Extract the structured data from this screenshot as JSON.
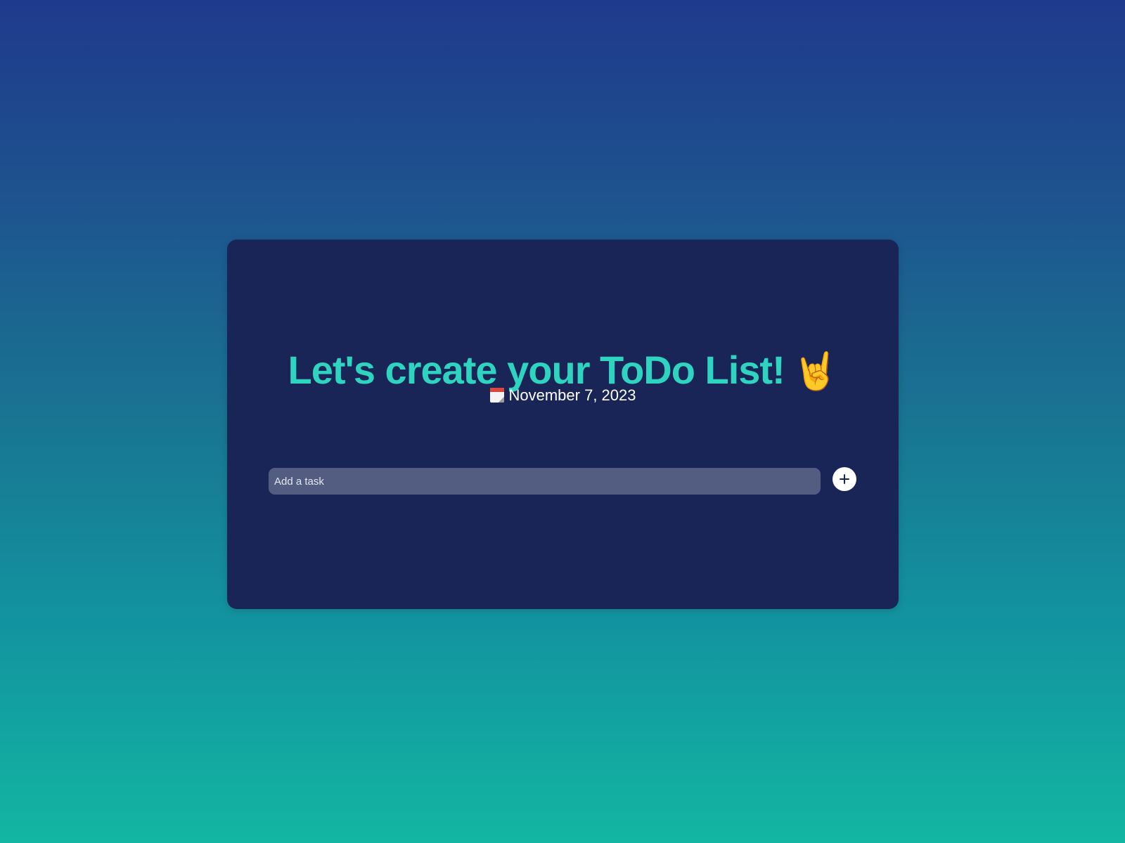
{
  "app": {
    "title": "Let's create your ToDo List!",
    "title_emoji": "🤘",
    "date": "November 7, 2023",
    "date_icon": "calendar-icon"
  },
  "task_input": {
    "placeholder": "Add a task",
    "value": ""
  },
  "add_button": {
    "icon": "plus-icon",
    "label": "Add task"
  },
  "colors": {
    "background_top": "#1f3a8c",
    "background_bottom": "#13b6a2",
    "card": "#182556",
    "title": "#2fd4c0",
    "input_bg": "#525d81",
    "button_bg": "#ffffff"
  }
}
